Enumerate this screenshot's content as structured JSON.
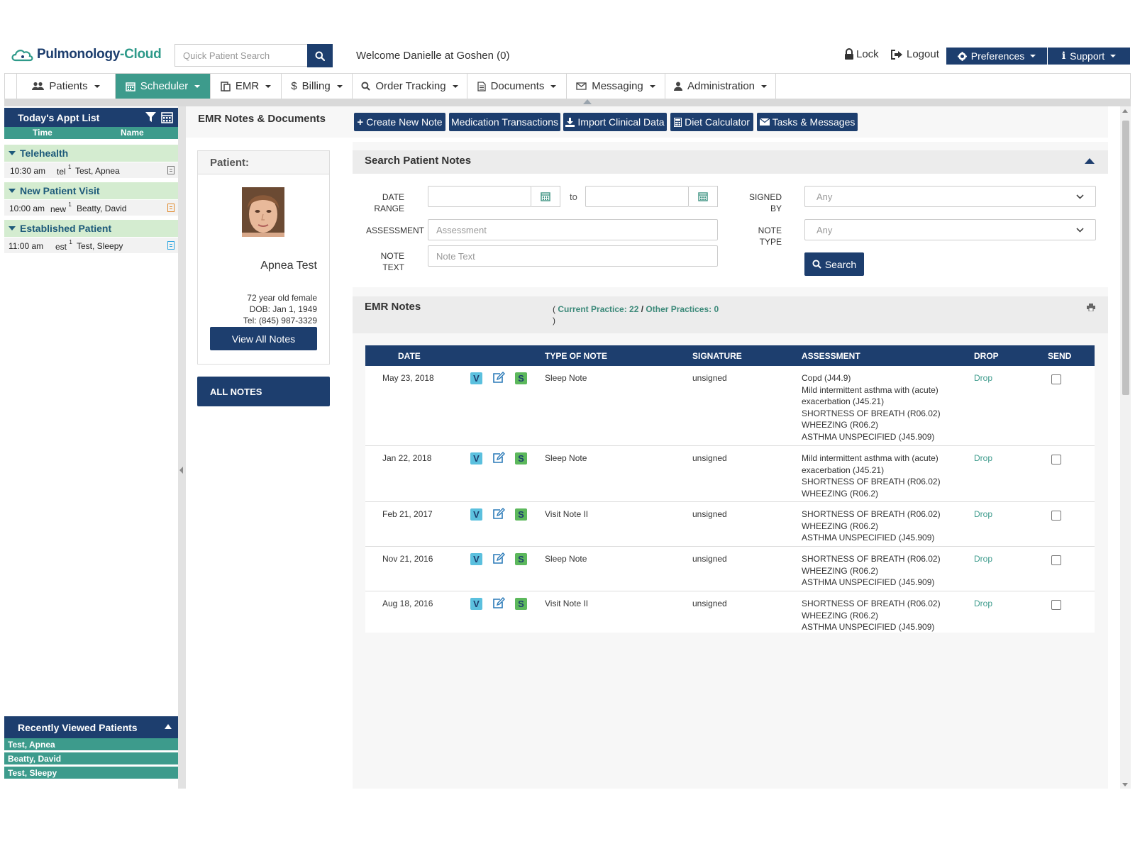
{
  "brand": {
    "name_part1": "Pulmonology",
    "sep": "-",
    "name_part2": "Cloud"
  },
  "header": {
    "quick_search_placeholder": "Quick Patient Search",
    "welcome": "Welcome Danielle at Goshen (0)",
    "lock": "Lock",
    "logout": "Logout",
    "preferences": "Preferences",
    "support": "Support"
  },
  "nav": [
    {
      "label": "Patients",
      "icon": "users-icon"
    },
    {
      "label": "Scheduler",
      "icon": "calendar-icon",
      "active": true
    },
    {
      "label": "EMR",
      "icon": "clipboard-icon"
    },
    {
      "label": "Billing",
      "icon": "dollar-icon"
    },
    {
      "label": "Order Tracking",
      "icon": "search-icon"
    },
    {
      "label": "Documents",
      "icon": "document-icon"
    },
    {
      "label": "Messaging",
      "icon": "envelope-icon"
    },
    {
      "label": "Administration",
      "icon": "user-icon"
    }
  ],
  "sidebar": {
    "appt_title": "Today's Appt List",
    "col_time": "Time",
    "col_name": "Name",
    "groups": [
      {
        "label": "Telehealth",
        "appts": [
          {
            "time": "10:30 am",
            "type": "tel",
            "sup": "1",
            "name": "Test, Apnea",
            "icon_color": "#777777"
          }
        ]
      },
      {
        "label": "New Patient Visit",
        "appts": [
          {
            "time": "10:00 am",
            "type": "new",
            "sup": "1",
            "name": "Beatty, David",
            "icon_color": "#e08a2c"
          }
        ]
      },
      {
        "label": "Established Patient",
        "appts": [
          {
            "time": "11:00 am",
            "type": "est",
            "sup": "1",
            "name": "Test, Sleepy",
            "icon_color": "#2ea6e0"
          }
        ]
      }
    ],
    "recent_title": "Recently Viewed Patients",
    "recent": [
      "Test, Apnea",
      "Beatty, David",
      "Test, Sleepy"
    ]
  },
  "main": {
    "title": "EMR Notes & Documents",
    "actions": [
      "Create New Note",
      "Medication Transactions",
      "Import Clinical Data",
      "Diet Calculator",
      "Tasks & Messages"
    ]
  },
  "patient": {
    "header": "Patient:",
    "name": "Apnea Test",
    "age_sex": "72 year old female",
    "dob": "DOB: Jan 1, 1949",
    "tel": "Tel: (845) 987-3329",
    "view_all": "View All Notes",
    "all_notes": "ALL NOTES"
  },
  "search": {
    "title": "Search Patient Notes",
    "date_label_1": "DATE",
    "date_label_2": "RANGE",
    "to": "to",
    "assessment_label": "ASSESSMENT",
    "assessment_placeholder": "Assessment",
    "note_text_label_1": "NOTE",
    "note_text_label_2": "TEXT",
    "note_text_placeholder": "Note Text",
    "signed_by_label_1": "SIGNED",
    "signed_by_label_2": "BY",
    "signed_by_value": "Any",
    "note_type_label_1": "NOTE",
    "note_type_label_2": "TYPE",
    "note_type_value": "Any",
    "search_button": "Search"
  },
  "emr": {
    "title": "EMR Notes",
    "counts_open": "(",
    "current_practice": "Current Practice: 22",
    "slash": "/",
    "other_practices": "Other Practices: 0",
    "counts_close": ")",
    "columns": [
      "DATE",
      "TYPE OF NOTE",
      "SIGNATURE",
      "ASSESSMENT",
      "DROP",
      "SEND"
    ],
    "badge_v": "V",
    "badge_s": "S",
    "rows": [
      {
        "date": "May 23, 2018",
        "type": "Sleep Note",
        "signature": "unsigned",
        "assessment": [
          "Copd (J44.9)",
          "Mild intermittent asthma with (acute)",
          "exacerbation (J45.21)",
          "SHORTNESS OF BREATH (R06.02)",
          "WHEEZING (R06.2)",
          "ASTHMA UNSPECIFIED (J45.909)"
        ],
        "drop": "Drop"
      },
      {
        "date": "Jan 22, 2018",
        "type": "Sleep Note",
        "signature": "unsigned",
        "assessment": [
          "Mild intermittent asthma with (acute)",
          "exacerbation (J45.21)",
          "SHORTNESS OF BREATH (R06.02)",
          "WHEEZING (R06.2)"
        ],
        "drop": "Drop"
      },
      {
        "date": "Feb 21, 2017",
        "type": "Visit Note II",
        "signature": "unsigned",
        "assessment": [
          "SHORTNESS OF BREATH (R06.02)",
          "WHEEZING (R06.2)",
          "ASTHMA UNSPECIFIED (J45.909)"
        ],
        "drop": "Drop"
      },
      {
        "date": "Nov 21, 2016",
        "type": "Sleep Note",
        "signature": "unsigned",
        "assessment": [
          "SHORTNESS OF BREATH (R06.02)",
          "WHEEZING (R06.2)",
          "ASTHMA UNSPECIFIED (J45.909)"
        ],
        "drop": "Drop"
      },
      {
        "date": "Aug 18, 2016",
        "type": "Visit Note II",
        "signature": "unsigned",
        "assessment": [
          "SHORTNESS OF BREATH (R06.02)",
          "WHEEZING (R06.2)",
          "ASTHMA UNSPECIFIED (J45.909)"
        ],
        "drop": "Drop"
      }
    ]
  },
  "colors": {
    "navy": "#1d3e6e",
    "teal": "#3d9b8c",
    "light_green": "#d4ecd0",
    "v_badge": "#5bc0de",
    "s_badge": "#5cb85c"
  }
}
